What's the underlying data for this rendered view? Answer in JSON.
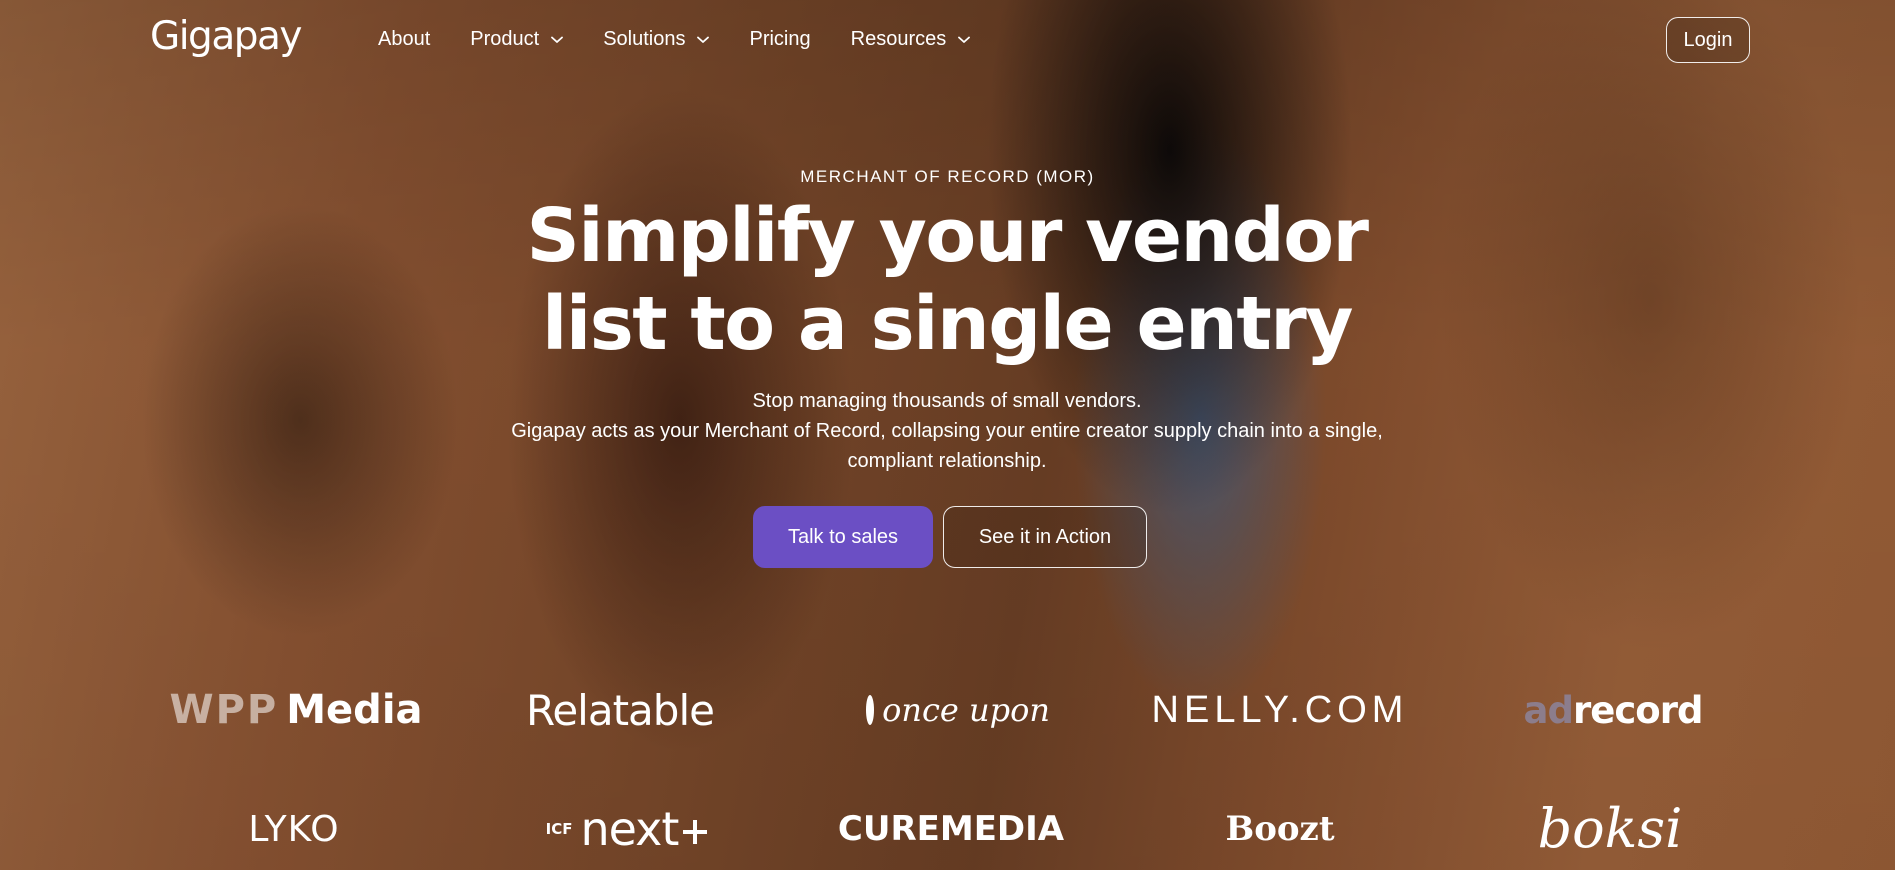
{
  "brand": {
    "name": "Gigapay"
  },
  "nav": {
    "items": [
      {
        "label": "About",
        "has_dropdown": false
      },
      {
        "label": "Product",
        "has_dropdown": true
      },
      {
        "label": "Solutions",
        "has_dropdown": true
      },
      {
        "label": "Pricing",
        "has_dropdown": false
      },
      {
        "label": "Resources",
        "has_dropdown": true
      }
    ],
    "login_label": "Login"
  },
  "hero": {
    "eyebrow": "MERCHANT OF RECORD (MOR)",
    "headline_line1": "Simplify your vendor",
    "headline_line2": "list to a single entry",
    "sub_line1": "Stop managing thousands of small vendors.",
    "sub_line2": "Gigapay acts as your Merchant of Record, collapsing your entire creator supply chain into a single,",
    "sub_line3": "compliant relationship.",
    "primary_cta": "Talk to sales",
    "secondary_cta": "See it in Action"
  },
  "logos": {
    "wpp_a": "WPP",
    "wpp_b": "Media",
    "relatable": "Relatable",
    "onceupon": "once upon",
    "nelly": "NELLY.COM",
    "adrecord_a": "ad",
    "adrecord_b": "record",
    "lyko": "LYKO",
    "icf": "ICF",
    "next": "next",
    "curemedia": "CUREMEDIA",
    "boozt": "Boozt",
    "boksi": "boksi"
  },
  "colors": {
    "accent": "#6b4fc4",
    "text": "#ffffff"
  }
}
